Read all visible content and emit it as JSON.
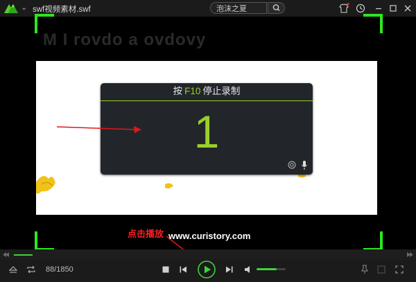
{
  "app": {
    "file_title": "swf视频素材.swf"
  },
  "search": {
    "value": "泡沫之夏"
  },
  "stage": {
    "background_text": "M I rovdo a ovdovy"
  },
  "recording_dialog": {
    "title_prefix": "按",
    "hotkey": "F10",
    "title_suffix": "停止录制",
    "countdown": "1"
  },
  "watermark": "www.curistory.com",
  "annotation": "点击播放",
  "player": {
    "frame_counter": "88/1850",
    "current_frame": 88,
    "total_frames": 1850,
    "volume_level": 0.7
  },
  "colors": {
    "accent": "#9bcf2a",
    "capture_corners": "#2ee51f",
    "play_green": "#3ed33e",
    "annotation_red": "#ff1e1e"
  },
  "icons": [
    "app-logo-icon",
    "chevron-down-icon",
    "search-icon",
    "tshirt-skin-icon",
    "history-clock-icon",
    "minimize-icon",
    "maximize-icon",
    "close-icon",
    "camera-icon",
    "microphone-icon",
    "eject-icon",
    "loop-icon",
    "stop-icon",
    "previous-icon",
    "play-icon",
    "next-icon",
    "volume-icon",
    "pin-icon",
    "fullscreen-icon"
  ]
}
